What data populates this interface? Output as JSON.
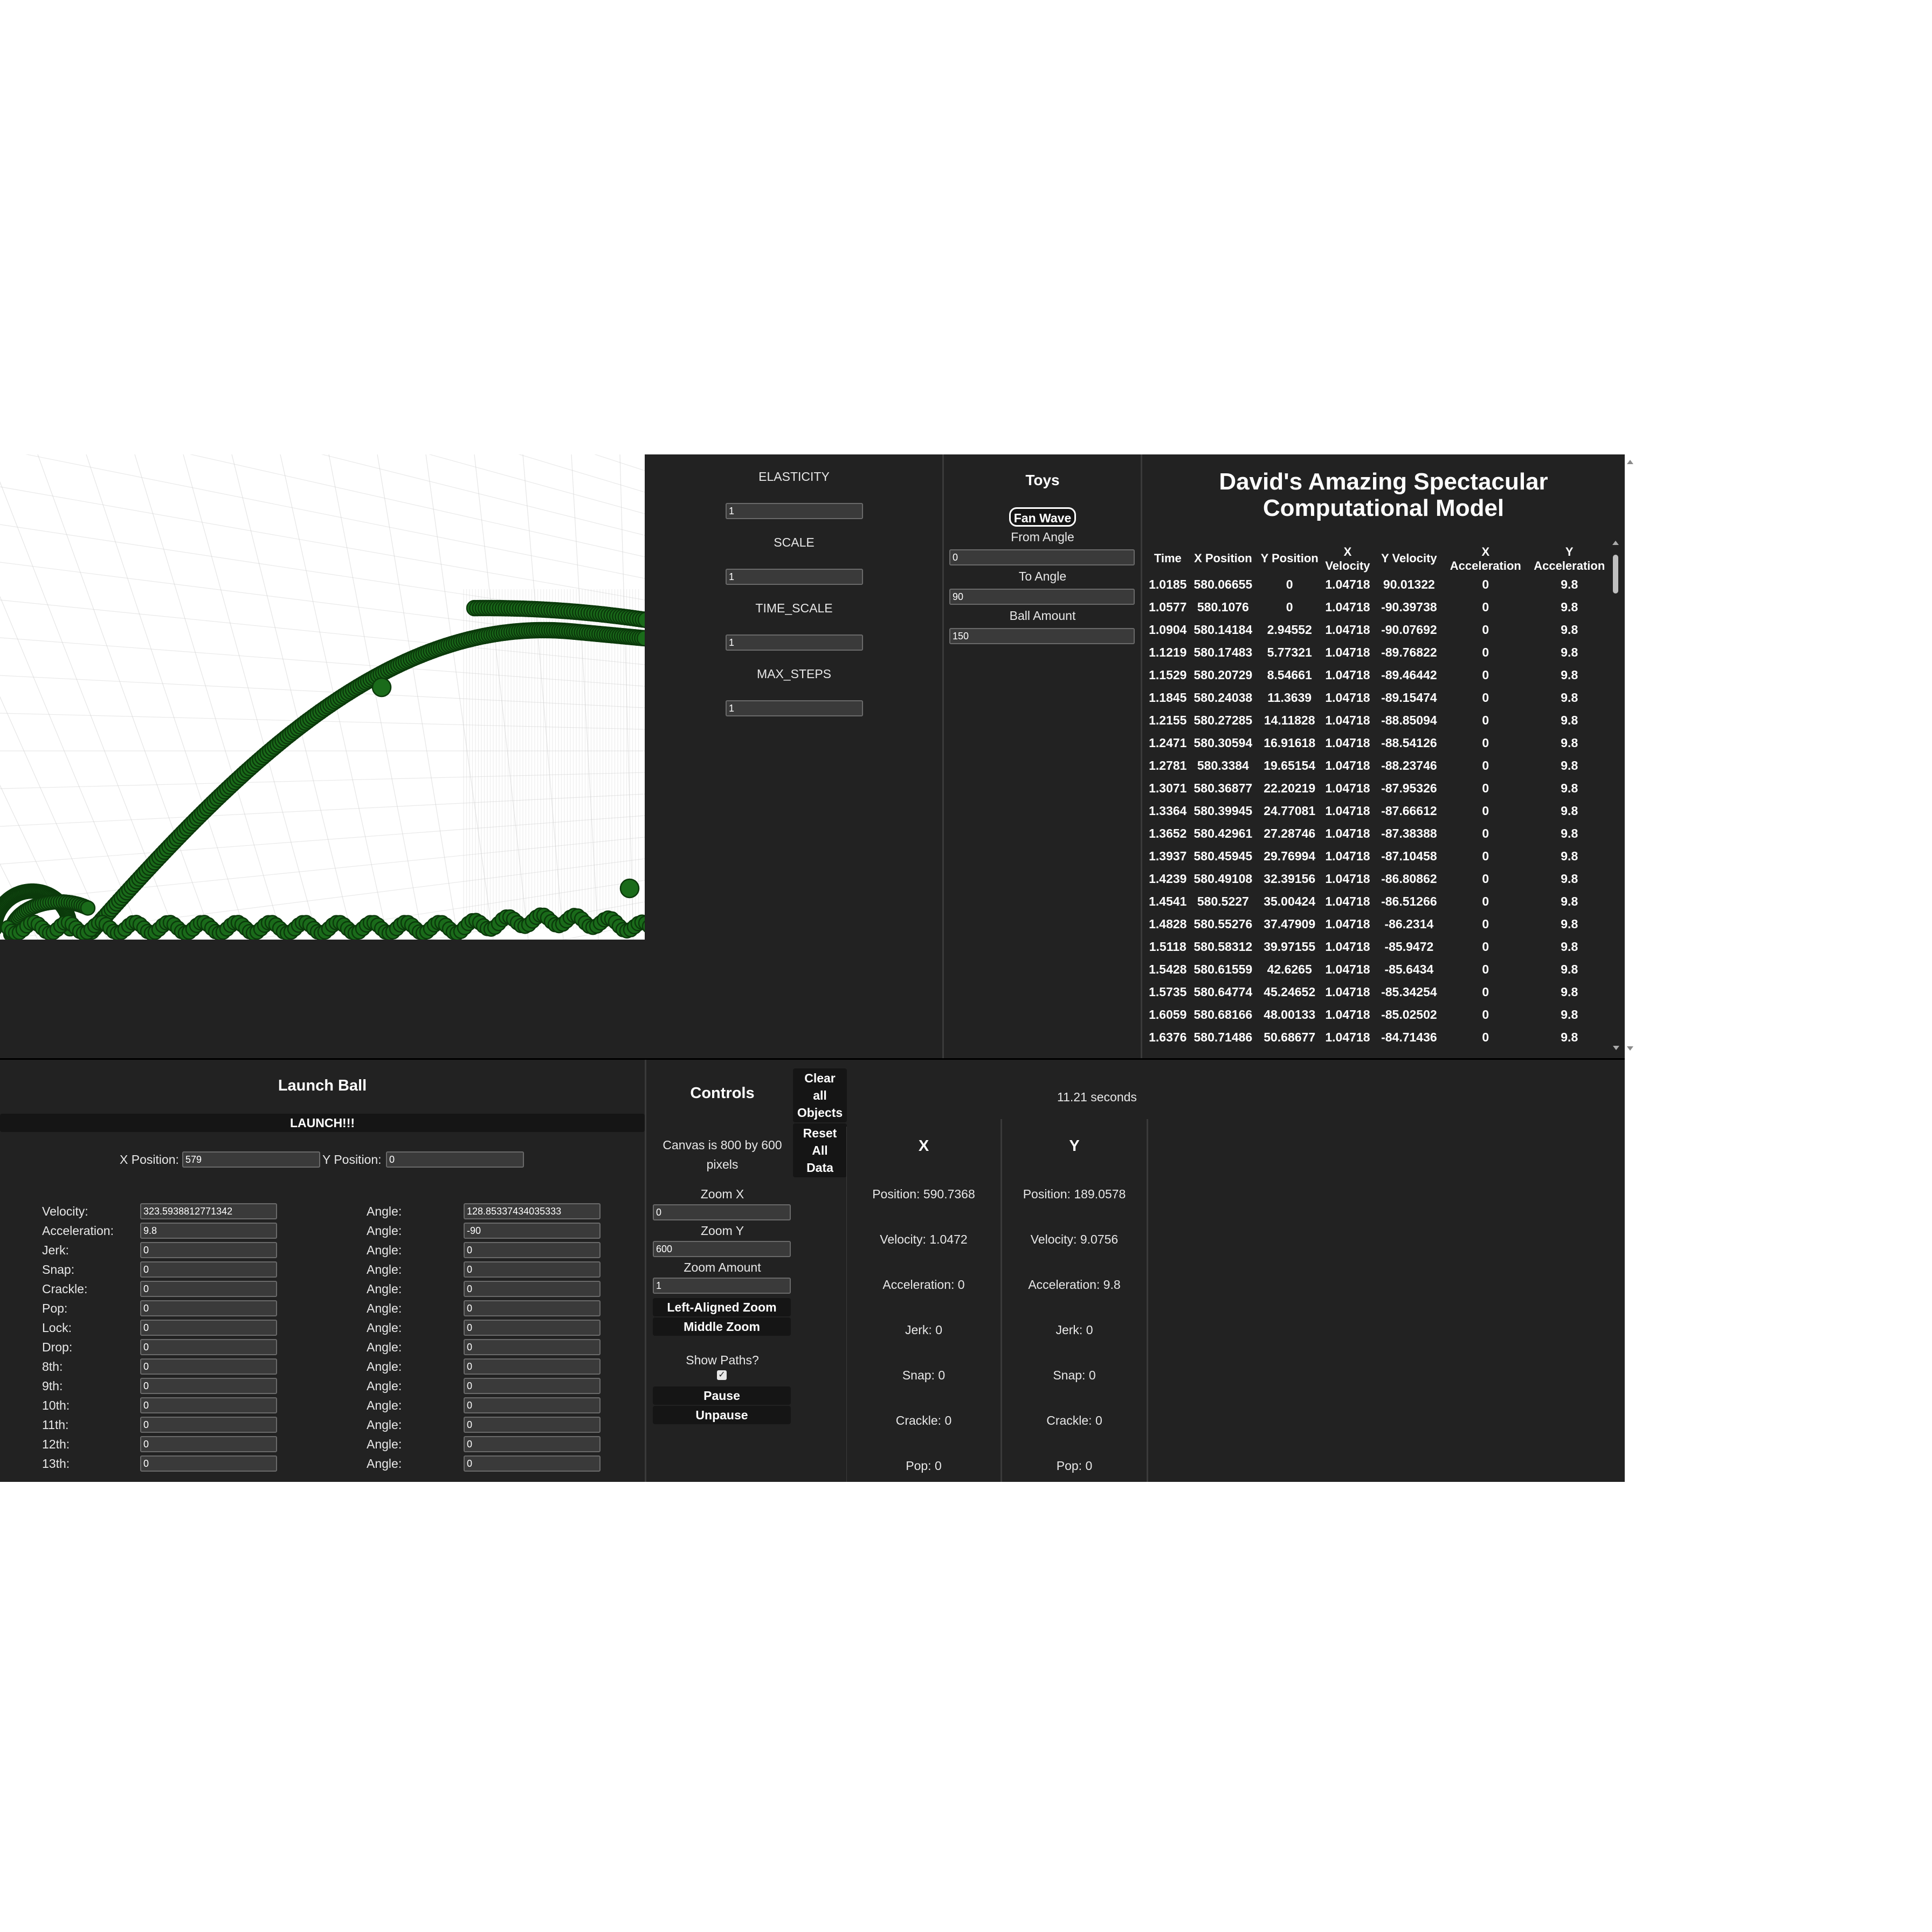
{
  "simulation": {
    "colors": {
      "ball": "#1a6b1a",
      "ball_outline": "#0b3a0b",
      "grid": "#cfcfcf",
      "panel": "#222222"
    }
  },
  "settings": {
    "fields": [
      {
        "label": "ELASTICITY",
        "value": "1"
      },
      {
        "label": "SCALE",
        "value": "1"
      },
      {
        "label": "TIME_SCALE",
        "value": "1"
      },
      {
        "label": "MAX_STEPS",
        "value": "1"
      }
    ]
  },
  "toys": {
    "title": "Toys",
    "fan_wave_button": "Fan Wave",
    "from_angle_label": "From Angle",
    "from_angle_value": "0",
    "to_angle_label": "To Angle",
    "to_angle_value": "90",
    "ball_amount_label": "Ball Amount",
    "ball_amount_value": "150"
  },
  "model": {
    "title_line1": "David's Amazing Spectacular",
    "title_line2": "Computational Model",
    "headers": [
      [
        "Time"
      ],
      [
        "X Position"
      ],
      [
        "Y Position"
      ],
      [
        "X",
        "Velocity"
      ],
      [
        "Y Velocity"
      ],
      [
        "X",
        "Acceleration"
      ],
      [
        "Y",
        "Acceleration"
      ]
    ],
    "rows": [
      [
        "1.0185",
        "580.06655",
        "0",
        "1.04718",
        "90.01322",
        "0",
        "9.8"
      ],
      [
        "1.0577",
        "580.1076",
        "0",
        "1.04718",
        "-90.39738",
        "0",
        "9.8"
      ],
      [
        "1.0904",
        "580.14184",
        "2.94552",
        "1.04718",
        "-90.07692",
        "0",
        "9.8"
      ],
      [
        "1.1219",
        "580.17483",
        "5.77321",
        "1.04718",
        "-89.76822",
        "0",
        "9.8"
      ],
      [
        "1.1529",
        "580.20729",
        "8.54661",
        "1.04718",
        "-89.46442",
        "0",
        "9.8"
      ],
      [
        "1.1845",
        "580.24038",
        "11.3639",
        "1.04718",
        "-89.15474",
        "0",
        "9.8"
      ],
      [
        "1.2155",
        "580.27285",
        "14.11828",
        "1.04718",
        "-88.85094",
        "0",
        "9.8"
      ],
      [
        "1.2471",
        "580.30594",
        "16.91618",
        "1.04718",
        "-88.54126",
        "0",
        "9.8"
      ],
      [
        "1.2781",
        "580.3384",
        "19.65154",
        "1.04718",
        "-88.23746",
        "0",
        "9.8"
      ],
      [
        "1.3071",
        "580.36877",
        "22.20219",
        "1.04718",
        "-87.95326",
        "0",
        "9.8"
      ],
      [
        "1.3364",
        "580.39945",
        "24.77081",
        "1.04718",
        "-87.66612",
        "0",
        "9.8"
      ],
      [
        "1.3652",
        "580.42961",
        "27.28746",
        "1.04718",
        "-87.38388",
        "0",
        "9.8"
      ],
      [
        "1.3937",
        "580.45945",
        "29.76994",
        "1.04718",
        "-87.10458",
        "0",
        "9.8"
      ],
      [
        "1.4239",
        "580.49108",
        "32.39156",
        "1.04718",
        "-86.80862",
        "0",
        "9.8"
      ],
      [
        "1.4541",
        "580.5227",
        "35.00424",
        "1.04718",
        "-86.51266",
        "0",
        "9.8"
      ],
      [
        "1.4828",
        "580.55276",
        "37.47909",
        "1.04718",
        "-86.2314",
        "0",
        "9.8"
      ],
      [
        "1.5118",
        "580.58312",
        "39.97155",
        "1.04718",
        "-85.9472",
        "0",
        "9.8"
      ],
      [
        "1.5428",
        "580.61559",
        "42.6265",
        "1.04718",
        "-85.6434",
        "0",
        "9.8"
      ],
      [
        "1.5735",
        "580.64774",
        "45.24652",
        "1.04718",
        "-85.34254",
        "0",
        "9.8"
      ],
      [
        "1.6059",
        "580.68166",
        "48.00133",
        "1.04718",
        "-85.02502",
        "0",
        "9.8"
      ],
      [
        "1.6376",
        "580.71486",
        "50.68677",
        "1.04718",
        "-84.71436",
        "0",
        "9.8"
      ]
    ]
  },
  "launch": {
    "title": "Launch Ball",
    "launch_button": "LAUNCH!!!",
    "x_label": "X Position:",
    "x_value": "579",
    "y_label": "Y Position:",
    "y_value": "0",
    "angle_label": "Angle:",
    "rows": [
      {
        "label": "Velocity:",
        "value": "323.5938812771342",
        "angle": "128.85337434035333"
      },
      {
        "label": "Acceleration:",
        "value": "9.8",
        "angle": "-90"
      },
      {
        "label": "Jerk:",
        "value": "0",
        "angle": "0"
      },
      {
        "label": "Snap:",
        "value": "0",
        "angle": "0"
      },
      {
        "label": "Crackle:",
        "value": "0",
        "angle": "0"
      },
      {
        "label": "Pop:",
        "value": "0",
        "angle": "0"
      },
      {
        "label": "Lock:",
        "value": "0",
        "angle": "0"
      },
      {
        "label": "Drop:",
        "value": "0",
        "angle": "0"
      },
      {
        "label": "8th:",
        "value": "0",
        "angle": "0"
      },
      {
        "label": "9th:",
        "value": "0",
        "angle": "0"
      },
      {
        "label": "10th:",
        "value": "0",
        "angle": "0"
      },
      {
        "label": "11th:",
        "value": "0",
        "angle": "0"
      },
      {
        "label": "12th:",
        "value": "0",
        "angle": "0"
      },
      {
        "label": "13th:",
        "value": "0",
        "angle": "0"
      }
    ]
  },
  "controls": {
    "title": "Controls",
    "clear_button": [
      "Clear",
      "all",
      "Objects"
    ],
    "reset_button": [
      "Reset",
      "All",
      "Data"
    ],
    "canvas_info_line1": "Canvas is 800 by 600",
    "canvas_info_line2": "pixels",
    "zoom_x_label": "Zoom X",
    "zoom_x_value": "0",
    "zoom_y_label": "Zoom Y",
    "zoom_y_value": "600",
    "zoom_amount_label": "Zoom Amount",
    "zoom_amount_value": "1",
    "left_zoom_button": "Left-Aligned Zoom",
    "middle_zoom_button": "Middle Zoom",
    "show_paths_label": "Show Paths?",
    "show_paths_checked": true,
    "pause_button": "Pause",
    "unpause_button": "Unpause"
  },
  "stats": {
    "time": "11.21 seconds",
    "x": {
      "header": "X",
      "lines": [
        "Position: 590.7368",
        "Velocity: 1.0472",
        "Acceleration: 0",
        "Jerk: 0",
        "Snap: 0",
        "Crackle: 0",
        "Pop: 0"
      ]
    },
    "y": {
      "header": "Y",
      "lines": [
        "Position: 189.0578",
        "Velocity: 9.0756",
        "Acceleration: 9.8",
        "Jerk: 0",
        "Snap: 0",
        "Crackle: 0",
        "Pop: 0"
      ]
    }
  }
}
